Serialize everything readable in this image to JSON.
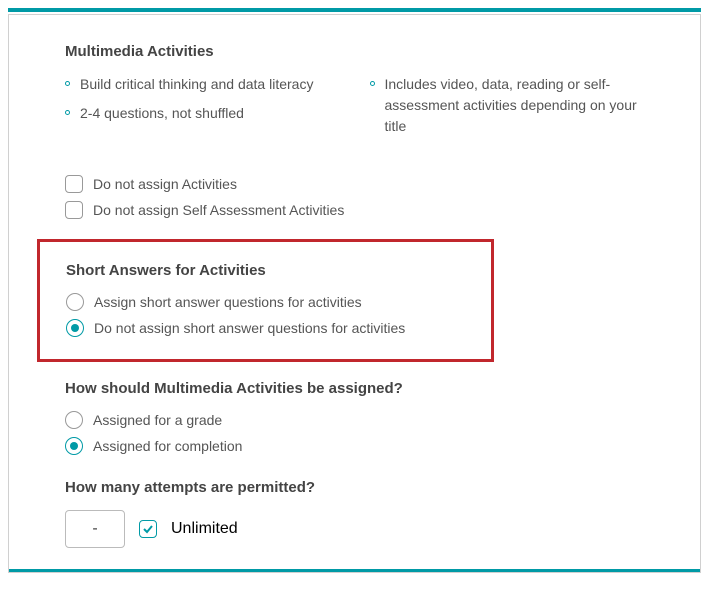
{
  "multimedia": {
    "title": "Multimedia Activities",
    "bullets_left": [
      "Build critical thinking and data literacy",
      "2-4 questions, not shuffled"
    ],
    "bullets_right": [
      "Includes video, data, reading or self-assessment activities depending on your title"
    ],
    "checkboxes": {
      "no_activities": "Do not assign Activities",
      "no_self_assessment": "Do not assign Self Assessment Activities"
    }
  },
  "short_answers": {
    "title": "Short Answers for Activities",
    "option_assign": "Assign short answer questions for activities",
    "option_no_assign": "Do not assign short answer questions for activities"
  },
  "how_assigned": {
    "title": "How should Multimedia Activities be assigned?",
    "option_grade": "Assigned for a grade",
    "option_completion": "Assigned for completion"
  },
  "attempts": {
    "title": "How many attempts are permitted?",
    "value": "-",
    "unlimited_label": "Unlimited"
  }
}
